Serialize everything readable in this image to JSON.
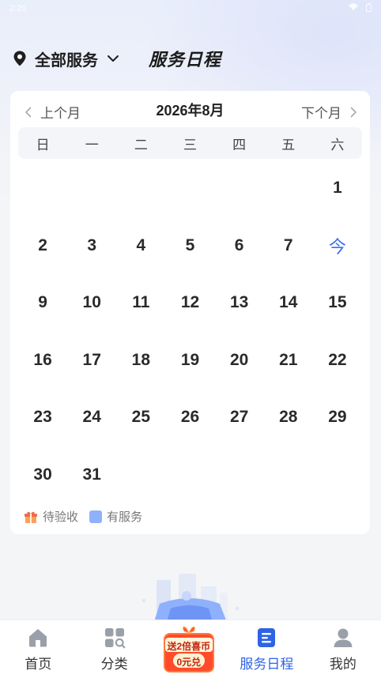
{
  "status_bar": {
    "time": "2:20"
  },
  "header": {
    "location_label": "全部服务",
    "title": "服务日程"
  },
  "calendar": {
    "month_title": "2026年8月",
    "prev_label": "上个月",
    "next_label": "下个月",
    "weekdays": [
      "日",
      "一",
      "二",
      "三",
      "四",
      "五",
      "六"
    ],
    "days": [
      "",
      "",
      "",
      "",
      "",
      "",
      "1",
      "2",
      "3",
      "4",
      "5",
      "6",
      "7",
      "今",
      "9",
      "10",
      "11",
      "12",
      "13",
      "14",
      "15",
      "16",
      "17",
      "18",
      "19",
      "20",
      "21",
      "22",
      "23",
      "24",
      "25",
      "26",
      "27",
      "28",
      "29",
      "30",
      "31",
      "",
      "",
      "",
      "",
      ""
    ],
    "today_label": "今"
  },
  "legend": {
    "pending": "待验收",
    "has_service": "有服务"
  },
  "bottom_nav": {
    "home": "首页",
    "category": "分类",
    "promo_line1": "送2倍喜币",
    "promo_line2": "0元兑",
    "schedule": "服务日程",
    "mine": "我的"
  },
  "colors": {
    "accent": "#2f63e6",
    "today": "#3d6ef0",
    "service_swatch": "#8fb1fb",
    "promo_red": "#ff4b2a"
  }
}
